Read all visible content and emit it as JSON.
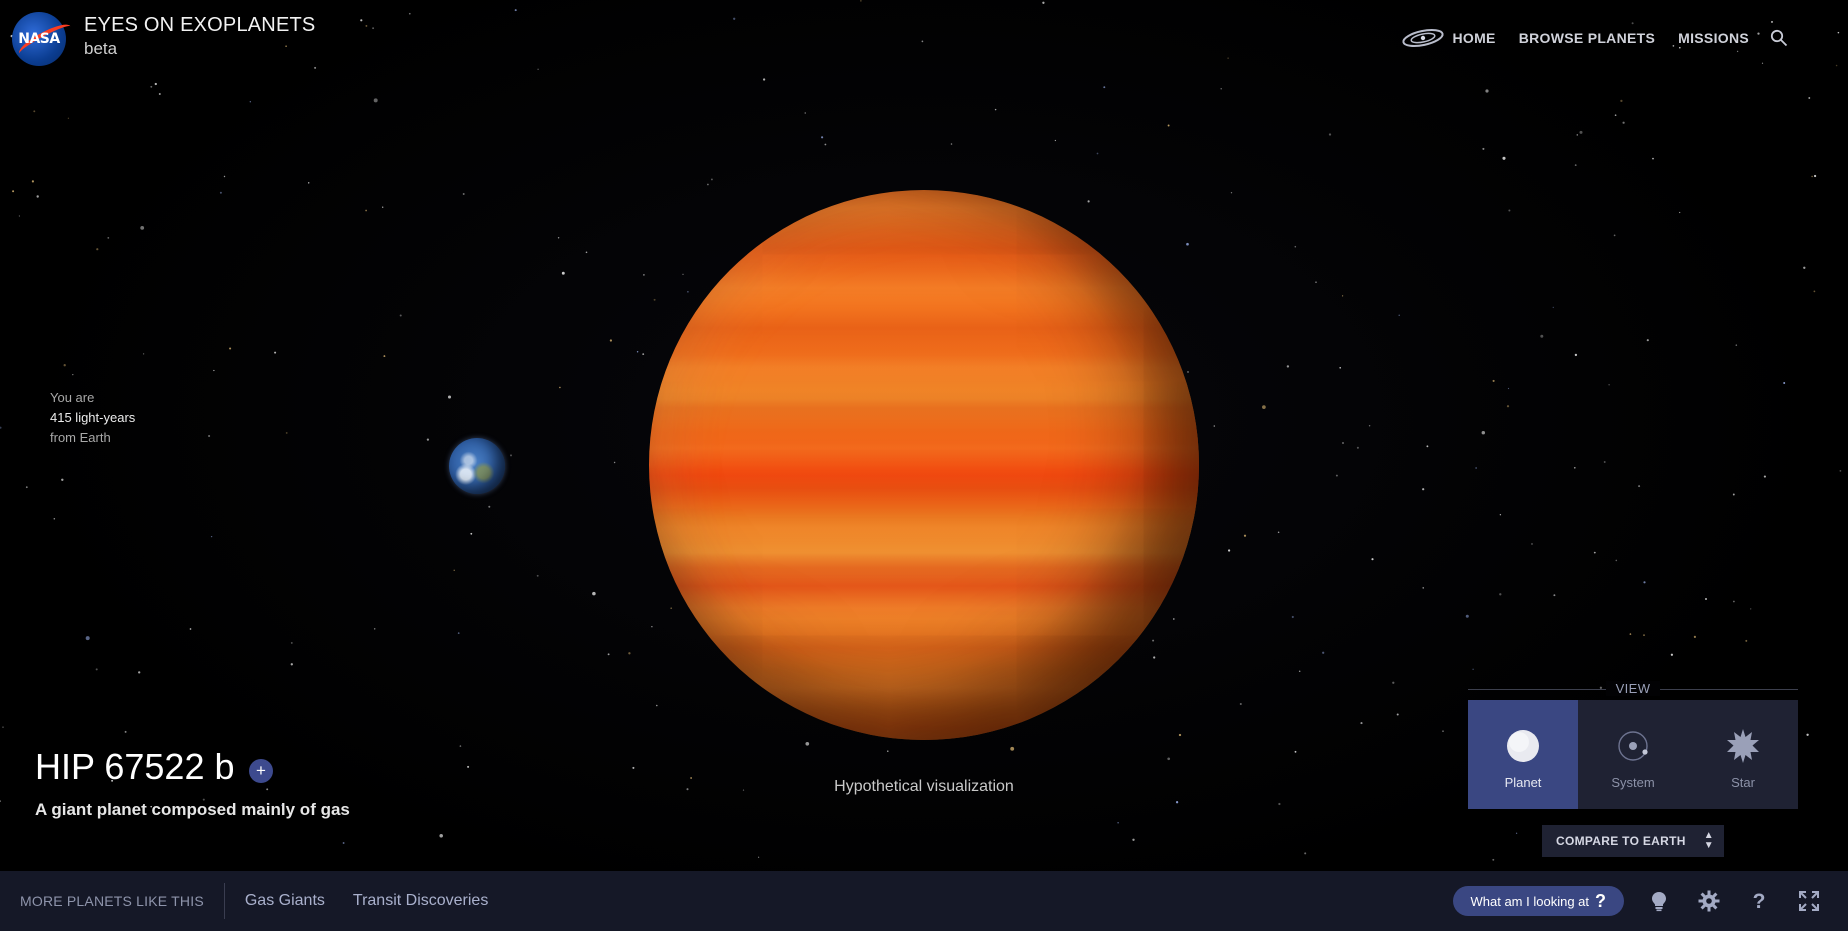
{
  "header": {
    "logo_text": "NASA",
    "title": "EYES ON EXOPLANETS",
    "subtitle": "beta",
    "nav": [
      {
        "label": "HOME",
        "icon": "galaxy-icon"
      },
      {
        "label": "BROWSE PLANETS"
      },
      {
        "label": "MISSIONS"
      }
    ],
    "search_icon": "search-icon"
  },
  "distance": {
    "line1": "You are",
    "value": "415 light-years",
    "line3": "from Earth"
  },
  "visual_caption": "Hypothetical visualization",
  "planet": {
    "name": "HIP 67522 b",
    "add_label": "+",
    "description": "A giant planet composed mainly of gas"
  },
  "view_panel": {
    "label": "VIEW",
    "options": [
      {
        "label": "Planet",
        "icon": "planet-icon",
        "active": true
      },
      {
        "label": "System",
        "icon": "system-icon",
        "active": false
      },
      {
        "label": "Star",
        "icon": "star-icon",
        "active": false
      }
    ],
    "compare_label": "COMPARE TO EARTH"
  },
  "bottom_bar": {
    "more_label": "MORE PLANETS LIKE THIS",
    "links": [
      "Gas Giants",
      "Transit Discoveries"
    ],
    "help_button": "What am I looking at",
    "help_symbol": "?",
    "icons": [
      "lightbulb-icon",
      "gear-icon",
      "question-icon",
      "fullscreen-icon"
    ]
  },
  "colors": {
    "accent": "#3a4782",
    "bottom_bar_bg": "#151827",
    "panel_bg": "#1f2233",
    "planet_orange": "#f2731e"
  }
}
